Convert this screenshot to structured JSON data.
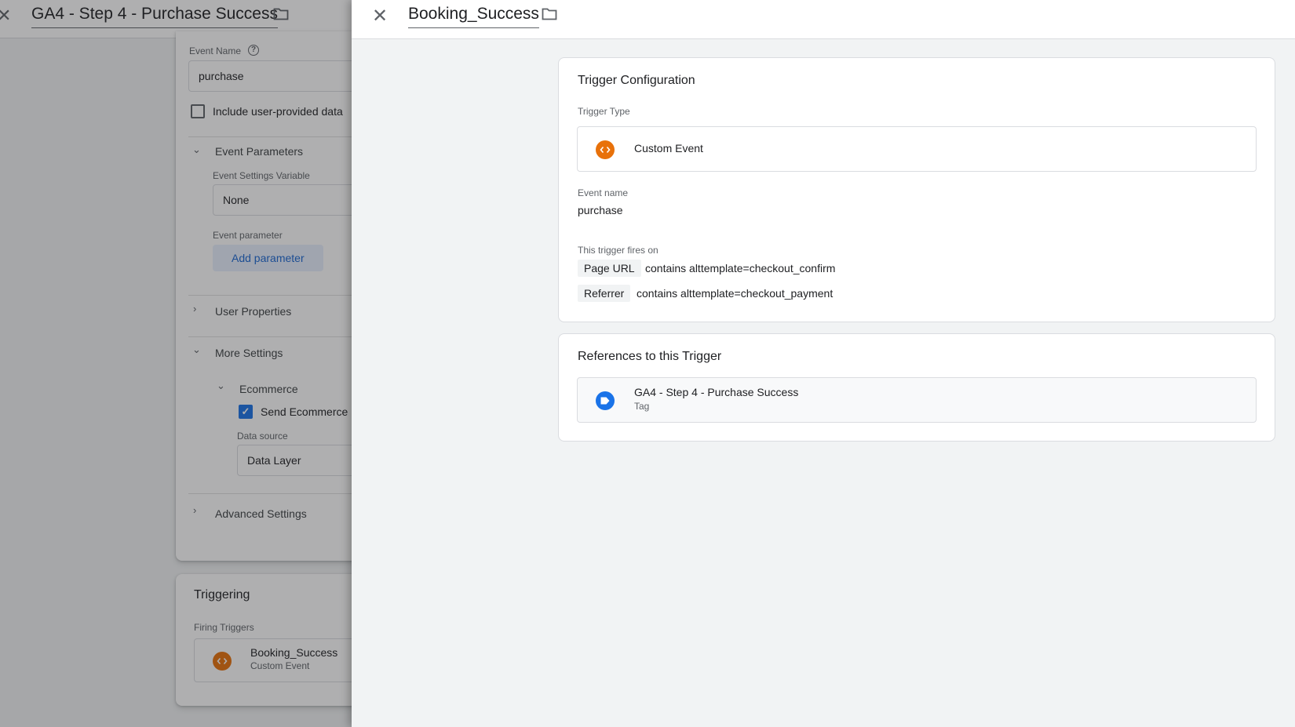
{
  "tag_editor": {
    "title": "GA4 - Step 4 - Purchase Success",
    "event_name_label": "Event Name",
    "event_name_value": "purchase",
    "include_user_data_label": "Include user-provided data",
    "event_parameters_label": "Event Parameters",
    "event_settings_variable_label": "Event Settings Variable",
    "event_settings_variable_value": "None",
    "event_parameter_label": "Event parameter",
    "add_parameter_label": "Add parameter",
    "user_properties_label": "User Properties",
    "more_settings_label": "More Settings",
    "ecommerce_label": "Ecommerce",
    "send_ecommerce_label": "Send Ecommerce",
    "send_ecommerce_checked": true,
    "data_source_label": "Data source",
    "data_source_value": "Data Layer",
    "advanced_settings_label": "Advanced Settings",
    "triggering_title": "Triggering",
    "firing_triggers_label": "Firing Triggers",
    "firing_trigger": {
      "name": "Booking_Success",
      "type": "Custom Event"
    }
  },
  "trigger_panel": {
    "title": "Booking_Success",
    "configuration": {
      "title": "Trigger Configuration",
      "trigger_type_label": "Trigger Type",
      "trigger_type": "Custom Event",
      "event_name_label": "Event name",
      "event_name": "purchase",
      "fires_on_label": "This trigger fires on",
      "conditions": [
        {
          "variable": "Page URL",
          "condition": "contains alttemplate=checkout_confirm"
        },
        {
          "variable": "Referrer",
          "condition": "contains alttemplate=checkout_payment"
        }
      ]
    },
    "references": {
      "title": "References to this Trigger",
      "items": [
        {
          "name": "GA4 - Step 4 - Purchase Success",
          "kind": "Tag"
        }
      ]
    }
  },
  "colors": {
    "custom_event_icon": "#e8710a",
    "tag_icon": "#1a73e8",
    "accent": "#1a73e8"
  },
  "icons": {
    "close": "close-icon",
    "folder": "folder-icon",
    "custom_event": "code-brackets-icon",
    "tag": "tag-icon"
  }
}
